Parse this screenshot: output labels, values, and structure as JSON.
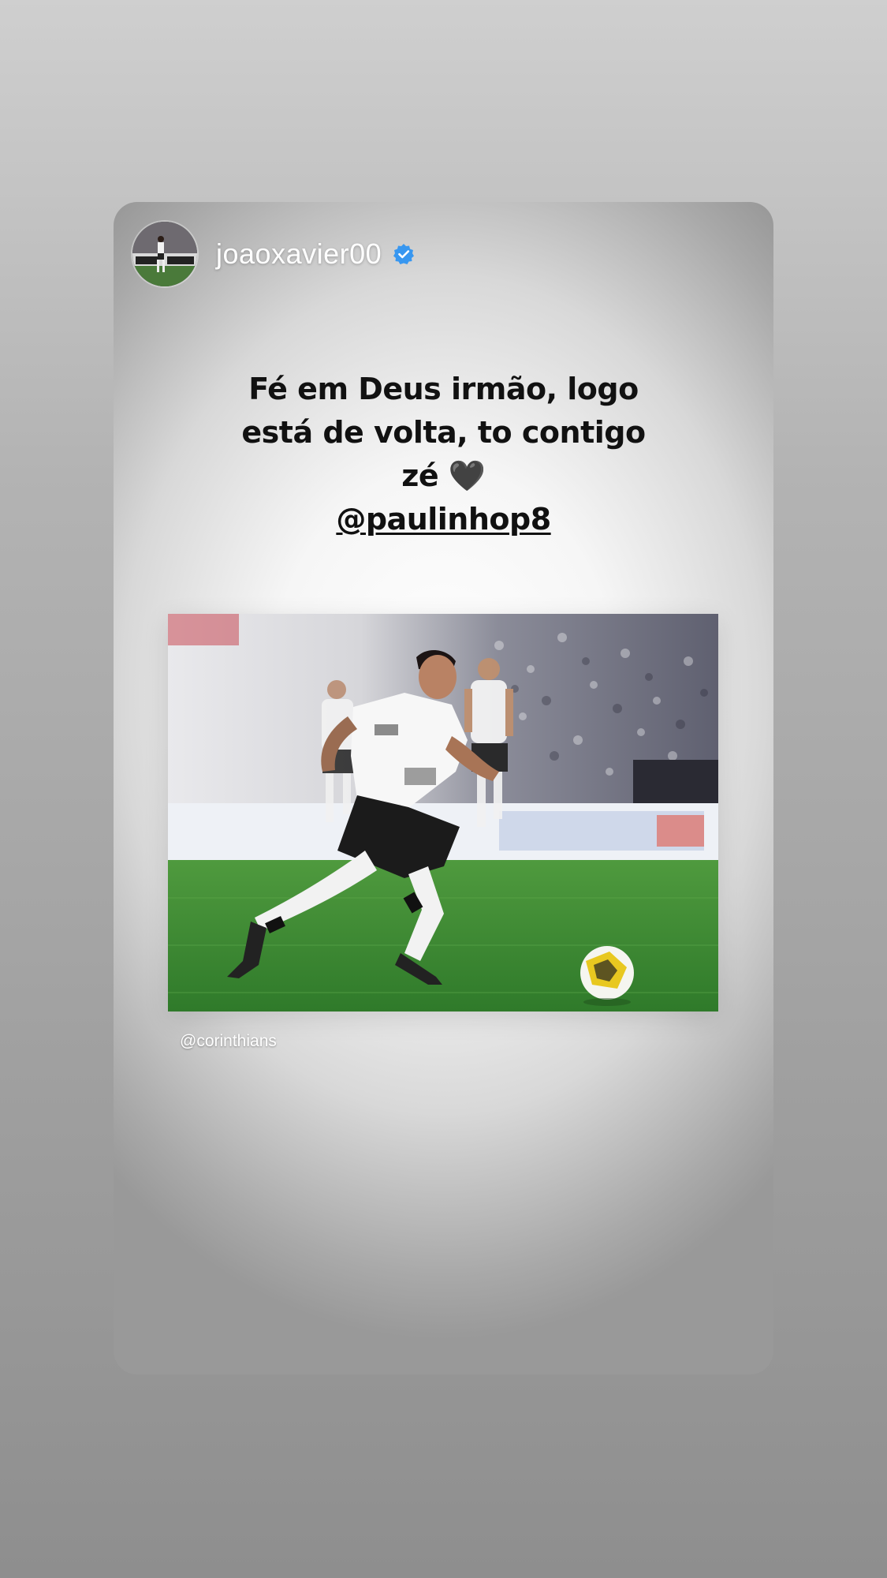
{
  "story": {
    "username": "joaoxavier00",
    "verified": true,
    "caption_lines": [
      "Fé em Deus irmão, logo",
      "está de volta, to contigo",
      "zé 🖤"
    ],
    "mention": "@paulinhop8",
    "photo_credit": "@corinthians"
  },
  "icons": {
    "avatar": "profile-photo",
    "verified": "verified-badge-icon"
  },
  "colors": {
    "verified_blue": "#3897f0",
    "caption_text": "#111111",
    "pitch_green": "#3f8a35"
  }
}
